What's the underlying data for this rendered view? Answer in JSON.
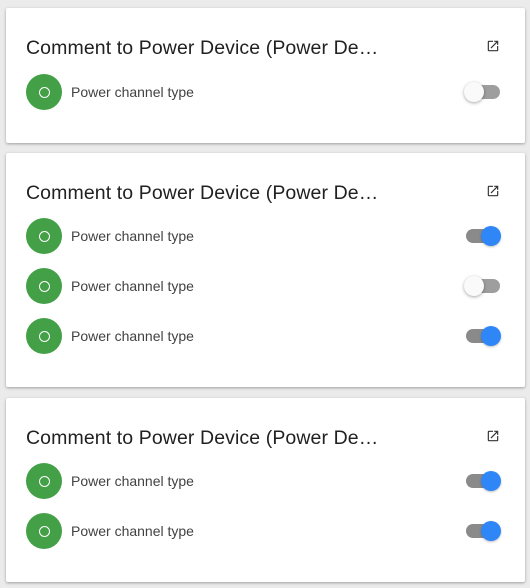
{
  "colors": {
    "status_green": "#43a047",
    "toggle_on": "#2f86f6",
    "toggle_off_thumb": "#fafafa",
    "background": "#ebebeb"
  },
  "cards": [
    {
      "title": "Comment to Power Device (Power Device)",
      "link_icon": "open-in-new-icon",
      "rows": [
        {
          "label": "Power channel type",
          "status_icon": "circle-outline-icon",
          "toggle_on": false
        }
      ]
    },
    {
      "title": "Comment to Power Device (Power Device)",
      "link_icon": "open-in-new-icon",
      "rows": [
        {
          "label": "Power channel type",
          "status_icon": "circle-outline-icon",
          "toggle_on": true
        },
        {
          "label": "Power channel type",
          "status_icon": "circle-outline-icon",
          "toggle_on": false
        },
        {
          "label": "Power channel type",
          "status_icon": "circle-outline-icon",
          "toggle_on": true
        }
      ]
    },
    {
      "title": "Comment to Power Device (Power Device)",
      "link_icon": "open-in-new-icon",
      "rows": [
        {
          "label": "Power channel type",
          "status_icon": "circle-outline-icon",
          "toggle_on": true
        },
        {
          "label": "Power channel type",
          "status_icon": "circle-outline-icon",
          "toggle_on": true
        }
      ]
    }
  ]
}
